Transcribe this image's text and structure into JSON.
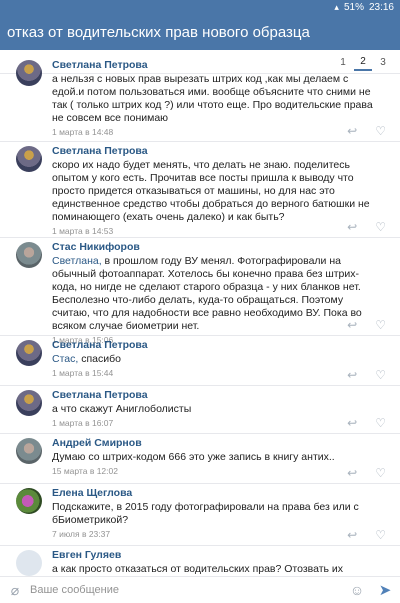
{
  "status": {
    "signal": "▴",
    "battery": "51%",
    "time": "23:16"
  },
  "header": {
    "title": "отказ от водительских прав нового образца"
  },
  "pager": {
    "pages": [
      "1",
      "2",
      "3"
    ],
    "current": "2"
  },
  "comments": [
    {
      "author": "Светлана Петрова",
      "avatar": "church",
      "reply_to": "",
      "text": "а нельзя с новых прав вырезать штрих код ,как мы делаем с едой.и потом пользоваться ими.     вообще объясните что сними не так ( только штрих код ?) или чтото еще. Про водительские права не совсем все понимаю",
      "date": "1 марта в 14:48"
    },
    {
      "author": "Светлана Петрова",
      "avatar": "church",
      "reply_to": "",
      "text": "скоро их надо будет менять, что делать не знаю. поделитесь опытом у кого есть. Прочитав все посты пришла к выводу что просто придется отказываться от машины, но для нас это единственное средство чтобы добраться до верного батюшки не поминающего (ехать очень далеко) и как быть?",
      "date": "1 марта в 14:53"
    },
    {
      "author": "Стас Никифоров",
      "avatar": "man",
      "reply_to": "Светлана,",
      "text": " в прошлом году ВУ менял. Фотографировали на обычный фотоаппарат. Хотелось бы конечно права без штрих-кода, но нигде не сделают старого образца - у них бланков нет. Бесполезно что-либо делать, куда-то обращаться. Поэтому считаю, что для надобности все равно необходимо ВУ. Пока во всяком случае биометрии нет.",
      "date": "1 марта в 15:06"
    },
    {
      "author": "Светлана Петрова",
      "avatar": "church",
      "reply_to": "Стас,",
      "text": " спасибо",
      "date": "1 марта в 15:44"
    },
    {
      "author": "Светлана Петрова",
      "avatar": "church",
      "reply_to": "",
      "text": "а что скажут Аниглоболисты",
      "date": "1 марта в 16:07"
    },
    {
      "author": "Андрей Смирнов",
      "avatar": "man",
      "reply_to": "",
      "text": "Думаю со штрих-кодом 666 это уже запись в книгу антих..",
      "date": "15 марта в 12:02"
    },
    {
      "author": "Елена Щеглова",
      "avatar": "flower",
      "reply_to": "",
      "text": "Подскажите, в 2015 году фотографировали на права без или с бБиометрикой?",
      "date": "7 июля в 23:37"
    },
    {
      "author": "Евген Гуляев",
      "avatar": "blank",
      "reply_to": "",
      "text": "а как просто отказаться от водительских прав? Отозвать их аргументируя",
      "date": ""
    }
  ],
  "composer": {
    "placeholder": "Ваше сообщение"
  },
  "icons": {
    "reply": "reply-icon",
    "like": "heart-icon",
    "attach": "paperclip-icon",
    "emoji": "smile-icon",
    "send": "send-icon"
  },
  "colors": {
    "brand": "#4a76a8",
    "link": "#2a5885",
    "muted": "#939393"
  }
}
